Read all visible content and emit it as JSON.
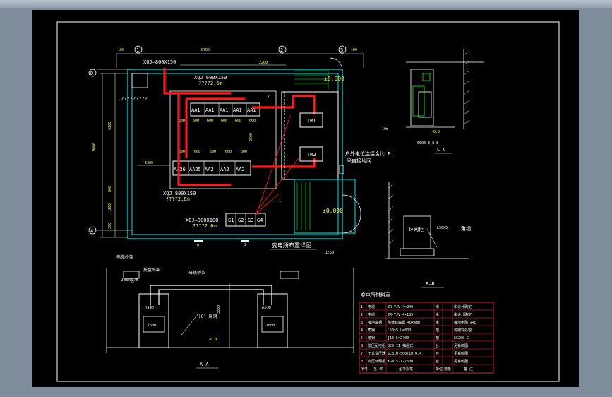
{
  "colors": {
    "background": "#000000",
    "wall": "#00e6e6",
    "cable": "#ff1a1a",
    "outline": "#ffffff",
    "dim": "#00ff66",
    "label": "#ffff66",
    "green": "#00ff00",
    "note": "#e0e0e0"
  },
  "plan": {
    "axis_labels": [
      "1",
      "2",
      "3",
      "D",
      "A"
    ],
    "dims": {
      "top_left": "100",
      "top_span": "8700",
      "top_right": "100",
      "span_2200": "2200",
      "left_9000": "9000",
      "left_5200": "5200",
      "left_800": "800",
      "left_1200": "1200",
      "left_300": "300",
      "mid_2500": "2500",
      "row": [
        "800",
        "600",
        "600",
        "600",
        "600",
        "600"
      ],
      "dim_2300": "2300"
    },
    "trench_labels": {
      "top": "XQJ—800X150",
      "inner": "XQJ—600X150",
      "inner_elev": "????2.6m",
      "bottom": "XQJ—800X150",
      "bottom_elev": "????2.6m",
      "low": "XQJ—300X100",
      "low_elev": "????2.6m"
    },
    "question_label": "?????????",
    "row1_panels": [
      "AA1",
      "AA1",
      "AA1",
      "AA1",
      "AA1"
    ],
    "row2_panels": [
      "AA26",
      "AA25",
      "AA2",
      "AA2",
      "AA2"
    ],
    "g_panels": [
      "G1",
      "G2",
      "G3",
      "G4"
    ],
    "transformers": [
      "TM1",
      "TM2"
    ],
    "elev_a": "±0.000",
    "elev_b": "±0.000",
    "note_line1": "户外电位连接金比 B",
    "note_line2": "采自接地网",
    "section_marks": [
      "A",
      "A",
      "B",
      "C",
      "7",
      "1"
    ],
    "small_nums": [
      "1",
      "2",
      "3",
      "4",
      "5",
      "6",
      "7",
      "8",
      "9",
      "10"
    ],
    "title": "变电所布置详图",
    "scale": "1:50"
  },
  "section_cc": {
    "title": "C—C",
    "elev": "±0.0",
    "elev_neg": "-0.0",
    "label_left": "10m",
    "label_small": "6000 3 8 8"
  },
  "section_bb": {
    "title": "B—B",
    "label1": "环网柜",
    "label2": "角钢",
    "dim": "L50X5"
  },
  "section_aa": {
    "title": "A—A",
    "label_trench": "电缆桥架",
    "label_support": "托盘吊架",
    "label_cable": "母线桥架",
    "left_note": "电缆桥架",
    "sub_note": "200kg/m",
    "cabinet_left": "G1柜",
    "cabinet_right": "G2柜",
    "left_box": "1600",
    "right_box": "1600",
    "mid_dim": "3800",
    "angle_label": "10° 扁钢",
    "elev": "-0.0",
    "right_dim": "2200"
  },
  "table": {
    "title": "变电所材料表",
    "rows": [
      [
        "1",
        "电缆",
        "ZR-YJV 4×240",
        "米",
        "由设计确定"
      ],
      [
        "2",
        "电缆",
        "ZR-YJV 4×185",
        "米",
        "由设计确定"
      ],
      [
        "3",
        "接地扁钢",
        "热镀锌扁钢 40×4mm",
        "米",
        "接地电阻 ≤4Ω"
      ],
      [
        "4",
        "角钢",
        "L50×5 L=800",
        "根",
        "热镀锌处理"
      ],
      [
        "5",
        "槽钢",
        "[10 L=2400",
        "根",
        "SS200 C"
      ],
      [
        "6",
        "低压配电柜",
        "GCS-II 抽屉式",
        "台",
        "见系统图"
      ],
      [
        "7",
        "干式变压器",
        "SCB10-500/10/0.4",
        "台",
        "见系统图"
      ],
      [
        "8",
        "高压环网柜",
        "XGN15-12/630",
        "台",
        "见系统图"
      ]
    ],
    "header": [
      "序号",
      "名  称",
      "型号规格",
      "单位",
      "数量",
      "备  注"
    ]
  }
}
